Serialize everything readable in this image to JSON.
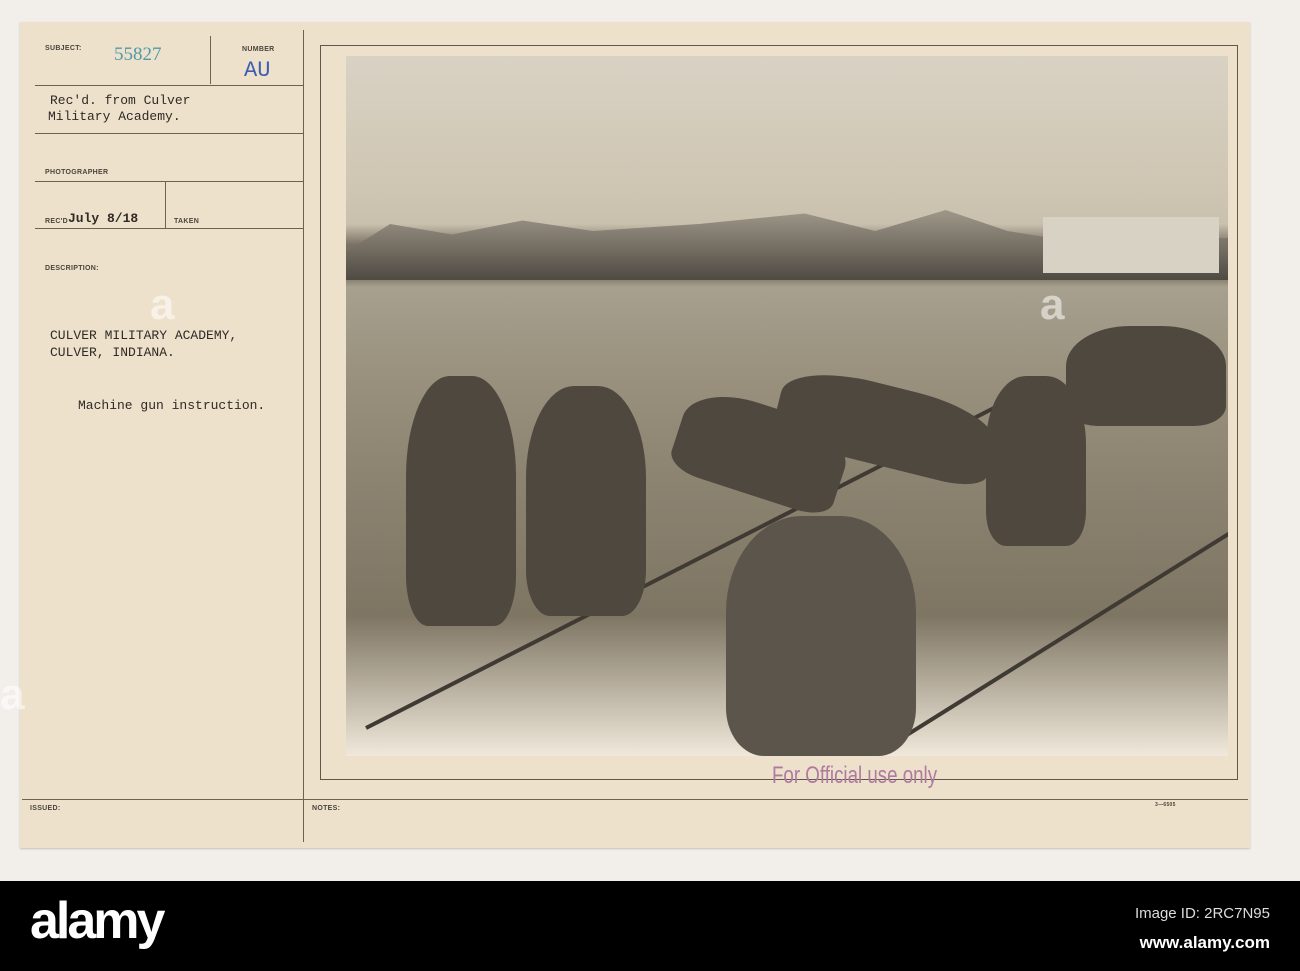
{
  "card": {
    "subject_label": "SUBJECT:",
    "subject_number": "55827",
    "number_label": "NUMBER",
    "number_value": "AU",
    "received_from_line1": "Rec'd. from Culver",
    "received_from_line2": "Military Academy.",
    "photographer_label": "PHOTOGRAPHER",
    "recd_label": "REC'D",
    "recd_date": "July 8/18",
    "taken_label": "TAKEN",
    "description_label": "DESCRIPTION:",
    "description_line1": "CULVER MILITARY ACADEMY,",
    "description_line2": "CULVER, INDIANA.",
    "caption": "Machine gun instruction.",
    "issued_label": "ISSUED:",
    "notes_label": "NOTES:",
    "form_code": "3—6505",
    "stamp": "For Official use only"
  },
  "colors": {
    "subject_number": "#4f9aa6",
    "number_value": "#3e5fb0",
    "stamp": "#b07aa0"
  },
  "watermark": {
    "logo": "alamy",
    "image_id": "Image ID: 2RC7N95",
    "url": "www.alamy.com"
  }
}
